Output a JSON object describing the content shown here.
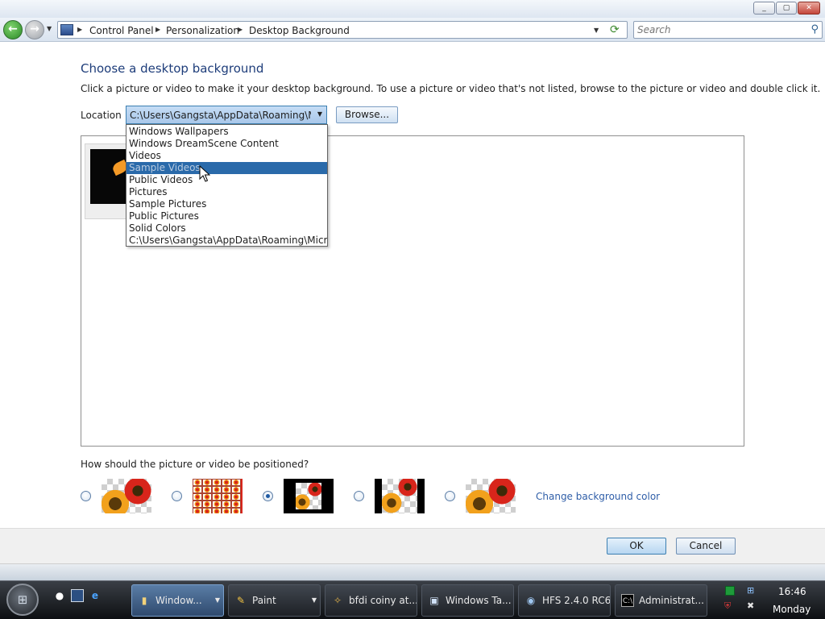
{
  "window": {
    "min_glyph": "_",
    "max_glyph": "▢",
    "close_glyph": "✕"
  },
  "navbar": {
    "back_glyph": "←",
    "forward_glyph": "→",
    "breadcrumbs": [
      "Control Panel",
      "Personalization",
      "Desktop Background"
    ],
    "search_placeholder": "Search"
  },
  "main": {
    "heading": "Choose a desktop background",
    "instructions": "Click a picture or video to make it your desktop background. To use a picture or video that's not listed, browse to the picture or video and double click it.",
    "location_label": "Location",
    "location_value": "C:\\Users\\Gangsta\\AppData\\Roaming\\Micr",
    "browse_label": "Browse...",
    "dropdown_options": [
      "Windows Wallpapers",
      "Windows DreamScene Content",
      "Videos",
      "Sample Videos",
      "Public Videos",
      "Pictures",
      "Sample Pictures",
      "Public Pictures",
      "Solid Colors",
      "C:\\Users\\Gangsta\\AppData\\Roaming\\Microsoft"
    ],
    "highlighted_option": "Sample Videos",
    "position_question": "How should the picture or video be positioned?",
    "position_selected_index": 2,
    "change_color_link": "Change background color"
  },
  "buttons": {
    "ok": "OK",
    "cancel": "Cancel"
  },
  "taskbar": {
    "tasks": [
      {
        "label": "Window...",
        "icon": "folder-icon",
        "active": true,
        "has_menu": true
      },
      {
        "label": "Paint",
        "icon": "paint-icon",
        "active": false,
        "has_menu": true
      },
      {
        "label": "bfdi coiny at...",
        "icon": "bfdi-icon",
        "active": false,
        "has_menu": false
      },
      {
        "label": "Windows Ta...",
        "icon": "task-manager-icon",
        "active": false,
        "has_menu": false
      },
      {
        "label": "HFS 2.4.0 RC6",
        "icon": "hfs-icon",
        "active": false,
        "has_menu": false
      },
      {
        "label": "Administrat...",
        "icon": "cmd-icon",
        "active": false,
        "has_menu": false
      }
    ],
    "clock_time": "16:46",
    "clock_day": "Monday"
  }
}
